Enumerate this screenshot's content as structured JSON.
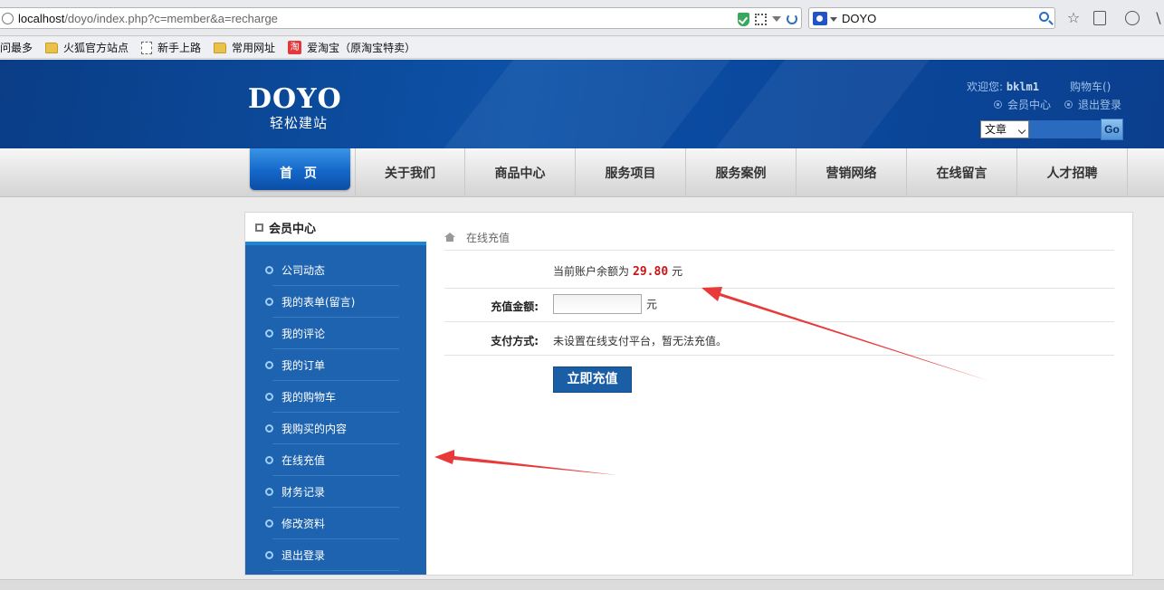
{
  "browser": {
    "url_host": "localhost",
    "url_path": "/doyo/index.php?c=member&a=recharge",
    "search_text": "DOYO",
    "bookmarks": [
      "问最多",
      "火狐官方站点",
      "新手上路",
      "常用网址",
      "爱淘宝（原淘宝特卖）"
    ],
    "menu_glyph": "\\"
  },
  "header": {
    "logo_word": "DOYO",
    "logo_sub": "轻松建站",
    "welcome_label": "欢迎您:",
    "username": "bklm1",
    "cart": "购物车()",
    "member_center": "会员中心",
    "logout": "退出登录",
    "search_select": "文章",
    "search_button": "Go"
  },
  "nav": {
    "home": "首 页",
    "items": [
      "关于我们",
      "商品中心",
      "服务项目",
      "服务案例",
      "营销网络",
      "在线留言",
      "人才招聘"
    ]
  },
  "sidebar": {
    "title": "会员中心",
    "items": [
      "公司动态",
      "我的表单(留言)",
      "我的评论",
      "我的订单",
      "我的购物车",
      "我购买的内容",
      "在线充值",
      "财务记录",
      "修改资料",
      "退出登录"
    ]
  },
  "main": {
    "breadcrumb": "在线充值",
    "balance_prefix": "当前账户余额为",
    "balance_amount": "29.80",
    "balance_unit": "元",
    "amount_label": "充值金额:",
    "amount_unit": "元",
    "pay_label": "支付方式:",
    "pay_value": "未设置在线支付平台，暂无法充值。",
    "submit": "立即充值"
  },
  "colors": {
    "header_blue": "#0d52a8",
    "sidebar_blue": "#1d63b0",
    "balance_red": "#c81414",
    "annotation_red": "#e83a3a"
  }
}
